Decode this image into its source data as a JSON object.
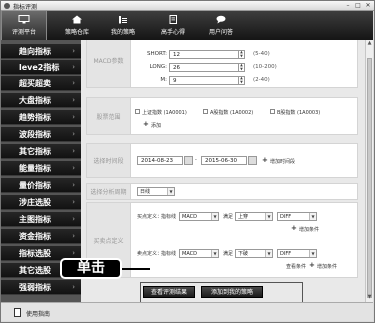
{
  "window": {
    "title": "指标评测",
    "min": "–",
    "max": "□",
    "close": "✕"
  },
  "nav": [
    {
      "label": "评测平台",
      "icon": "monitor-icon"
    },
    {
      "label": "策略仓库",
      "icon": "home-icon"
    },
    {
      "label": "我的策略",
      "icon": "stats-icon"
    },
    {
      "label": "高手心得",
      "icon": "notebook-icon"
    },
    {
      "label": "用户问答",
      "icon": "chat-icon"
    }
  ],
  "sidebar": [
    "趋向指标",
    "leve2指标",
    "超买超卖",
    "大盘指标",
    "趋势指标",
    "波段指标",
    "其它指标",
    "能量指标",
    "量价指标",
    "涉庄选股",
    "主图指标",
    "资金指标",
    "指标选股",
    "其它选股",
    "强弱指标"
  ],
  "params": {
    "section_label": "MACD参数",
    "rows": [
      {
        "name": "SHORT:",
        "value": "12",
        "range": "(5-40)"
      },
      {
        "name": "LONG:",
        "value": "26",
        "range": "(10-200)"
      },
      {
        "name": "M:",
        "value": "9",
        "range": "(2-40)"
      }
    ]
  },
  "index_range": {
    "section_label": "股票范围",
    "items": [
      "上证指数 (1A0001)",
      "A股指数 (1A0002)",
      "B股指数 (1A0003)"
    ],
    "add_label": "添加"
  },
  "time_range": {
    "section_label": "选择时间段",
    "start": "2014-08-23",
    "end": "2015-06-30",
    "add_label": "增加时间段"
  },
  "period": {
    "section_label": "选择分析周期",
    "value": "日线"
  },
  "buy_sell": {
    "section_label": "买卖点定义",
    "buy": {
      "prefix": "买点定义：",
      "mid": "指标线",
      "line": "MACD",
      "op_prefix": "满足",
      "op": "上穿",
      "target": "DIFF",
      "add": "增加条件"
    },
    "sell": {
      "prefix": "卖点定义：",
      "mid": "指标线",
      "line": "MACD",
      "op_prefix": "满足",
      "op": "下破",
      "target": "DIFF",
      "view": "查看条件",
      "add": "增加条件"
    }
  },
  "actions": {
    "view_result": "查看评测结果",
    "add_to_mine": "添加到我的策略"
  },
  "callout": "单击",
  "status": {
    "help": "使用指南"
  }
}
